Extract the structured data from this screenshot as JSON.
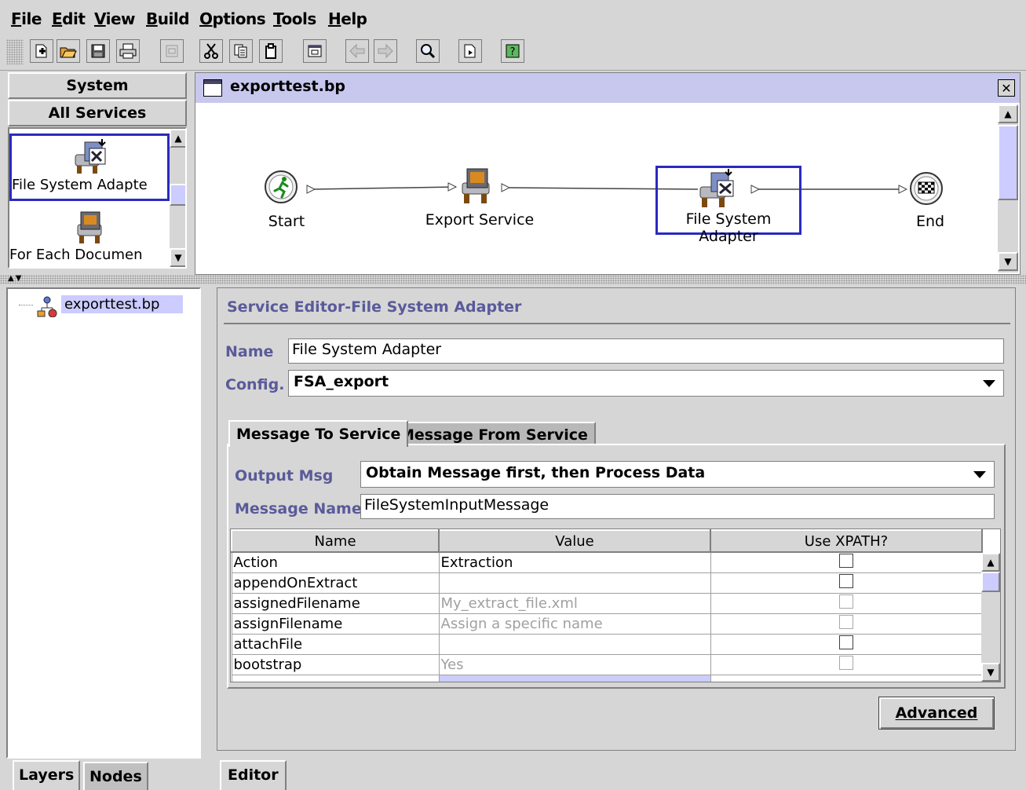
{
  "menu": [
    {
      "label": "File",
      "u": "F",
      "rest": "ile"
    },
    {
      "label": "Edit",
      "u": "E",
      "rest": "dit"
    },
    {
      "label": "View",
      "u": "V",
      "rest": "iew"
    },
    {
      "label": "Build",
      "u": "B",
      "rest": "uild"
    },
    {
      "label": "Options",
      "u": "O",
      "rest": "ptions"
    },
    {
      "label": "Tools",
      "u": "T",
      "rest": "ools"
    },
    {
      "label": "Help",
      "u": "H",
      "rest": "elp"
    }
  ],
  "toolbar": {
    "icons": [
      "new-icon",
      "open-icon",
      "save-icon",
      "print-icon",
      "properties-icon",
      "cut-icon",
      "copy-icon",
      "paste-icon",
      "window-icon",
      "back-icon",
      "forward-icon",
      "find-icon",
      "check-in-icon",
      "help-icon"
    ]
  },
  "palette": {
    "header_system": "System",
    "header_services": "All Services",
    "items": [
      {
        "label": "File System Adapte",
        "icon": "file-system-adapter-icon"
      },
      {
        "label": "For Each Documen",
        "icon": "computer-service-icon"
      }
    ]
  },
  "canvas": {
    "title": "exporttest.bp",
    "nodes": [
      {
        "label": "Start",
        "icon": "start-runner-icon"
      },
      {
        "label": "Export Service",
        "icon": "computer-service-icon"
      },
      {
        "label": "File System Adapter",
        "icon": "file-system-adapter-icon"
      },
      {
        "label": "End",
        "icon": "checkered-flag-icon"
      }
    ]
  },
  "tree": {
    "root": "exporttest.bp"
  },
  "left_tabs": [
    "Layers",
    "Nodes"
  ],
  "editor": {
    "title": "Service Editor-File System Adapter",
    "name_label": "Name",
    "name_value": "File System Adapter",
    "config_label": "Config.",
    "config_value": "FSA_export",
    "tabs": [
      "Message To Service",
      "Message From Service"
    ],
    "output_msg_label": "Output Msg",
    "output_msg_value": "Obtain Message first, then Process Data",
    "message_name_label": "Message Name",
    "message_name_value": "FileSystemInputMessage",
    "table": {
      "columns": [
        "Name",
        "Value",
        "Use XPATH?"
      ],
      "rows": [
        {
          "name": "Action",
          "value": "Extraction",
          "value_style": "normal",
          "xpath_enabled": true
        },
        {
          "name": "appendOnExtract",
          "value": "",
          "value_style": "normal",
          "xpath_enabled": true
        },
        {
          "name": "assignedFilename",
          "value": "My_extract_file.xml",
          "value_style": "grey",
          "xpath_enabled": false
        },
        {
          "name": "assignFilename",
          "value": "Assign a specific name",
          "value_style": "grey",
          "xpath_enabled": false
        },
        {
          "name": "attachFile",
          "value": "",
          "value_style": "normal",
          "xpath_enabled": true
        },
        {
          "name": "bootstrap",
          "value": "Yes",
          "value_style": "grey",
          "xpath_enabled": false
        }
      ]
    },
    "advanced_label": "Advanced",
    "bottom_tab": "Editor"
  },
  "colors": {
    "background": "#d6d6d6",
    "selection_border": "#2a2ac0",
    "label_text": "#5a5a9a",
    "title_bar": "#c8c8ee",
    "thumb": "#ccccff"
  }
}
